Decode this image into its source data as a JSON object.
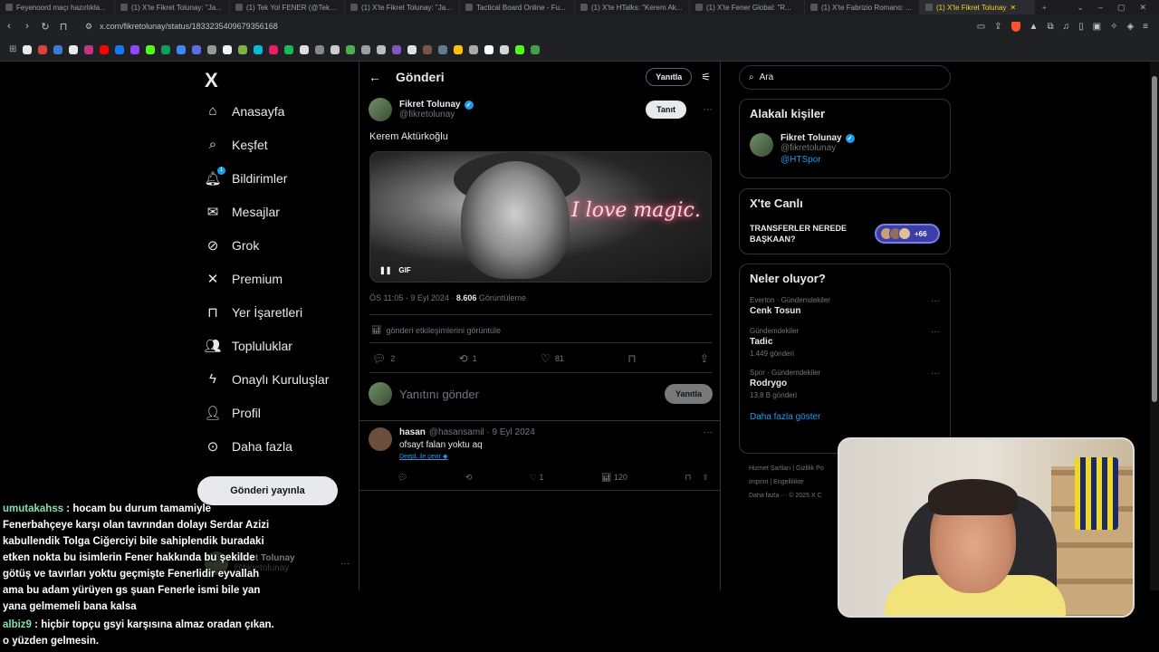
{
  "browser": {
    "tabs": [
      {
        "title": "Feyenoord maçı hazırlıkla...",
        "active": false
      },
      {
        "title": "(1) X'te Fikret Tolunay: \"Ja...",
        "active": false
      },
      {
        "title": "(1) Tek Yol FENER (@TekYo...",
        "active": false
      },
      {
        "title": "(1) X'te Fikret Tolunay: \"Ja...",
        "active": false
      },
      {
        "title": "Tactical Board Online - Fu...",
        "active": false
      },
      {
        "title": "(1) X'te HTalks: \"Kerem Ak...",
        "active": false
      },
      {
        "title": "(1) X'te Fener Global: \"R...",
        "active": false
      },
      {
        "title": "(1) X'te Fabrizio Romano: ...",
        "active": false
      },
      {
        "title": "(1) X'te Fikret Tolunay",
        "active": true
      }
    ],
    "url": "x.com/fikretolunay/status/1833235409679356168"
  },
  "sidebar": {
    "logo": "X",
    "items": [
      {
        "label": "Anasayfa",
        "icon": "home-icon"
      },
      {
        "label": "Keşfet",
        "icon": "search-icon"
      },
      {
        "label": "Bildirimler",
        "icon": "bell-icon",
        "badge": "1"
      },
      {
        "label": "Mesajlar",
        "icon": "mail-icon"
      },
      {
        "label": "Grok",
        "icon": "grok-icon"
      },
      {
        "label": "Premium",
        "icon": "x-icon"
      },
      {
        "label": "Yer İşaretleri",
        "icon": "bookmark-icon"
      },
      {
        "label": "Topluluklar",
        "icon": "communities-icon"
      },
      {
        "label": "Onaylı Kuruluşlar",
        "icon": "lightning-icon"
      },
      {
        "label": "Profil",
        "icon": "profile-icon"
      },
      {
        "label": "Daha fazla",
        "icon": "more-circle-icon"
      }
    ],
    "post_button": "Gönderi yayınla",
    "profile": {
      "name": "Fikret Tolunay",
      "handle": "@fikretolunay"
    }
  },
  "main": {
    "header_title": "Gönderi",
    "reply_outline": "Yanıtla",
    "tweet": {
      "name": "Fikret Tolunay",
      "handle": "@fikretolunay",
      "follow": "Tanıt",
      "text": "Kerem Aktürkoğlu",
      "media_overlay_text": "I love magic.",
      "gif_label": "GIF",
      "time": "ÖS 11:05 · 9 Eyl 2024 · ",
      "views": "8.606",
      "views_label": " Görüntüleme",
      "analytics": "gönderi etkileşimlerini görüntüle",
      "replies": "2",
      "retweets": "1",
      "likes": "81"
    },
    "reply_box": {
      "placeholder": "Yanıtını gönder",
      "button": "Yanıtla"
    },
    "comment": {
      "name": "hasan",
      "handle": "@hasansamil · 9 Eyl 2024",
      "text": "ofsayt falan yoktu aq",
      "translate": "DeepL ile çevir",
      "likes": "1",
      "views": "120"
    }
  },
  "right": {
    "search_placeholder": "Ara",
    "related_title": "Alakalı kişiler",
    "related": {
      "name": "Fikret Tolunay",
      "handle": "@fikretolunay",
      "link": "@HTSpor"
    },
    "live_title": "X'te Canlı",
    "live_text": "TRANSFERLER NEREDE BAŞKAAN?",
    "live_count": "+66",
    "trends_title": "Neler oluyor?",
    "trends": [
      {
        "category": "Everton · Gündemdekiler",
        "name": "Cenk Tosun",
        "count": ""
      },
      {
        "category": "Gündemdekiler",
        "name": "Tadic",
        "count": "1.449 gönderi"
      },
      {
        "category": "Spor · Gündemdekiler",
        "name": "Rodrygo",
        "count": "13,8 B gönderi"
      }
    ],
    "show_more": "Daha fazla göster",
    "footer": [
      "Hizmet Şartları  |  Gizlilik Po",
      "Imprint  |  Engellilikte",
      "Daha fazla ···  © 2025 X C"
    ]
  },
  "chat": [
    {
      "user": "umutakahss",
      "text": " : hocam bu durum tamamiyle Fenerbahçeye karşı olan tavrından dolayı Serdar Azizi kabullendik Tolga Ciğerciyi bile sahiplendik buradaki etken nokta bu isimlerin Fener hakkında bu şekilde götüş ve tavırları yoktu geçmişte Fenerlidir eyvallah ama bu adam yürüyen gs şuan Fenerle ismi bile yan yana gelmemeli bana kalsa"
    },
    {
      "user": "albiz9",
      "text": " : hiçbir topçu gsyi karşısına almaz oradan çıkan. o yüzden gelmesin."
    }
  ],
  "colors": {
    "accent": "#1d9bf0",
    "bg": "#000000",
    "chat_user": "#7fe3b1"
  }
}
